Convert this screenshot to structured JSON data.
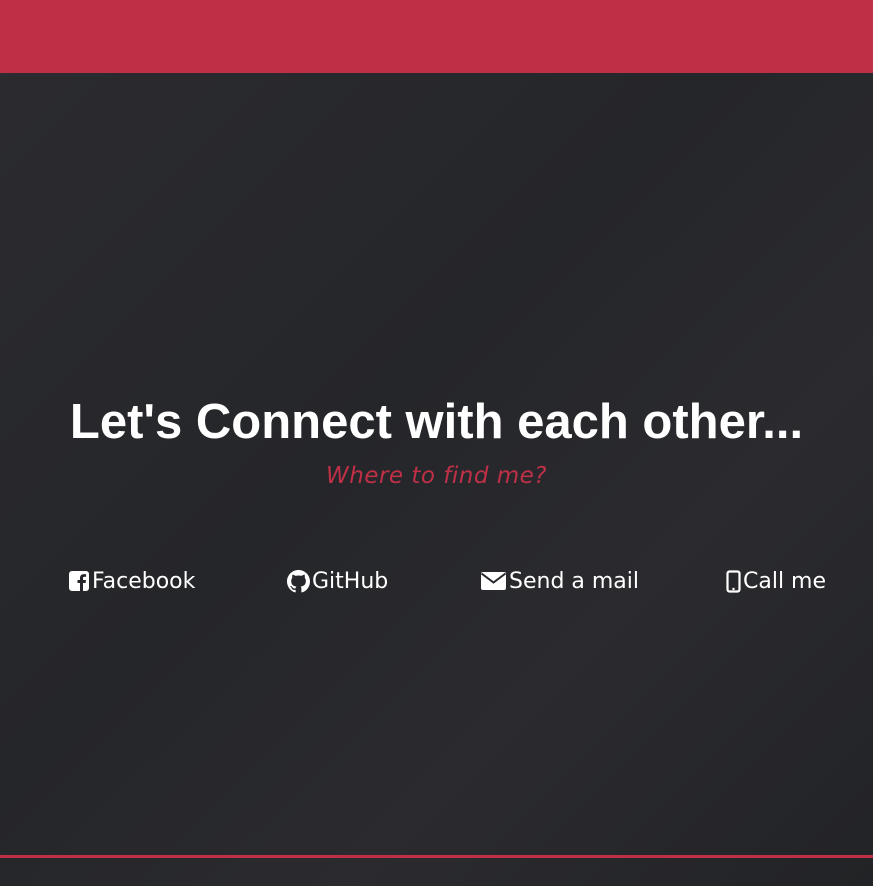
{
  "colors": {
    "accent": "#bf3047",
    "background": "#26272b",
    "text": "#ffffff"
  },
  "hero": {
    "title": "Let's Connect with each other...",
    "subtitle": "Where to find me?"
  },
  "contact_links": [
    {
      "label": "Facebook",
      "icon": "facebook-icon"
    },
    {
      "label": "GitHub",
      "icon": "github-icon"
    },
    {
      "label": "Send a mail",
      "icon": "mail-icon"
    },
    {
      "label": "Call me",
      "icon": "phone-icon"
    }
  ]
}
